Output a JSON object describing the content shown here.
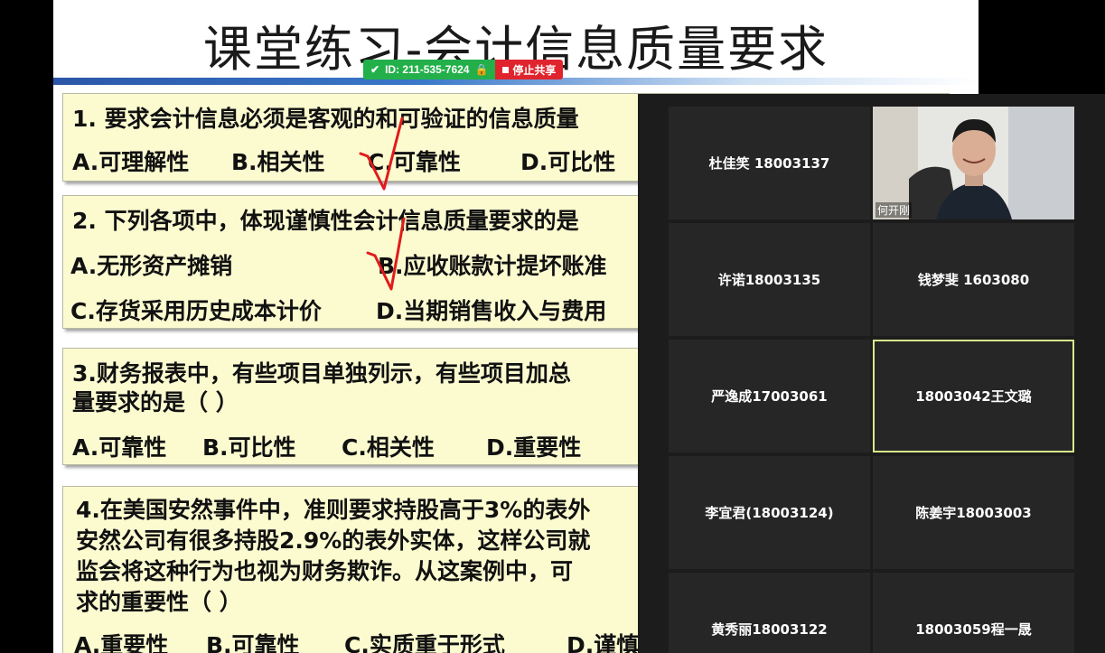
{
  "share_bar": {
    "meeting_id": "ID: 211-535-7624",
    "stop_label": "停止共享"
  },
  "slide": {
    "title": "课堂练习-会计信息质量要求",
    "q1": {
      "stem": "1.  要求会计信息必须是客观的和可验证的信息质量",
      "options": [
        "A.可理解性",
        "B.相关性",
        "C.可靠性",
        "D.可比性"
      ]
    },
    "q2": {
      "stem": "2.  下列各项中，体现谨慎性会计信息质量要求的是",
      "options": [
        "A.无形资产摊销",
        "B.应收账款计提坏账准",
        "C.存货采用历史成本计价",
        "D.当期销售收入与费用"
      ]
    },
    "q3": {
      "stem_line1": "3.财务报表中，有些项目单独列示，有些项目加总",
      "stem_line2": "量要求的是（  ）",
      "options": [
        "A.可靠性",
        "B.可比性",
        "C.相关性",
        "D.重要性"
      ]
    },
    "q4": {
      "stem_line1": "4.在美国安然事件中，准则要求持股高于3%的表外",
      "stem_line2": "安然公司有很多持股2.9%的表外实体，这样公司就",
      "stem_line3": "监会将这种行为也视为财务欺诈。从这案例中，可",
      "stem_line4": "求的重要性（  ）",
      "options": [
        "A.重要性",
        "B.可靠性",
        "C.实质重于形式",
        "D.谨慎"
      ]
    }
  },
  "participants": {
    "video_name": "何开刚",
    "tiles": [
      {
        "label": "杜佳笑 18003137"
      },
      {
        "label": "许诺18003135"
      },
      {
        "label": "钱梦斐 1603080"
      },
      {
        "label": "严逸成17003061"
      },
      {
        "label": "18003042王文璐"
      },
      {
        "label": "李宜君(18003124)"
      },
      {
        "label": "陈姜宇18003003"
      },
      {
        "label": "黄秀丽18003122"
      },
      {
        "label": "18003059程一晟"
      }
    ]
  },
  "colors": {
    "question_bg": "#fcfbd0",
    "share_green": "#23b04a",
    "share_red": "#e0242d",
    "active_tile_border": "#d7e98c",
    "annotation_red": "#e21b1b"
  }
}
